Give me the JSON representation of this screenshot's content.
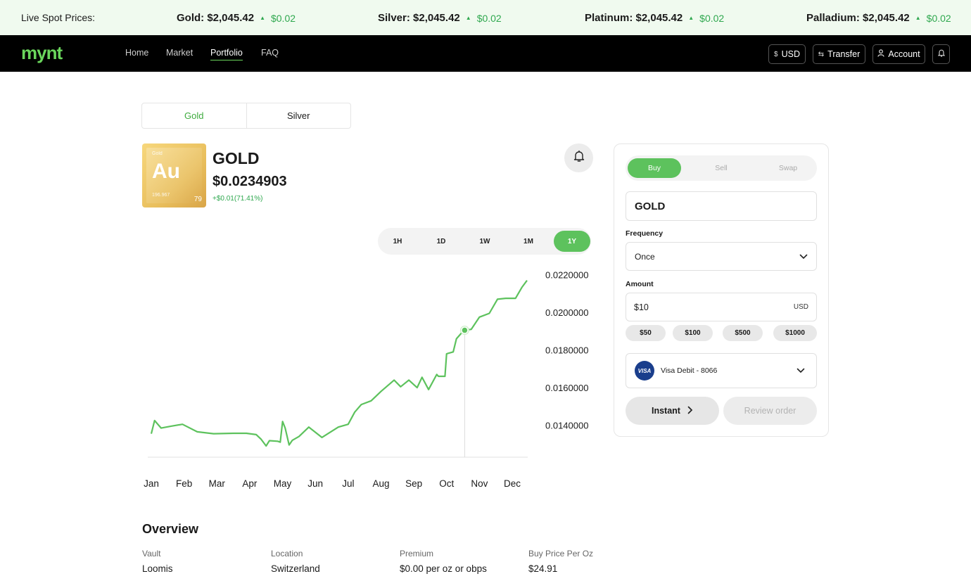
{
  "ticker": {
    "label": "Live Spot Prices:",
    "items": [
      {
        "name": "Gold: $2,045.42",
        "change": "$0.02"
      },
      {
        "name": "Silver: $2,045.42",
        "change": "$0.02"
      },
      {
        "name": "Platinum: $2,045.42",
        "change": "$0.02"
      },
      {
        "name": "Palladium: $2,045.42",
        "change": "$0.02"
      }
    ]
  },
  "nav": {
    "logo": "mynt",
    "links": [
      "Home",
      "Market",
      "Portfolio",
      "FAQ"
    ],
    "active": "Portfolio",
    "currency_label": "USD",
    "transfer_label": "Transfer",
    "account_label": "Account"
  },
  "metal_tabs": [
    "Gold",
    "Silver"
  ],
  "asset": {
    "tile_small": "Gold",
    "symbol": "Au",
    "atomic_mass": "196.967",
    "atomic_number": "79",
    "name": "GOLD",
    "price": "$0.0234903",
    "change": "+$0.01(71.41%)"
  },
  "ranges": [
    "1H",
    "1D",
    "1W",
    "1M",
    "1Y"
  ],
  "selected_range": "1Y",
  "chart_data": {
    "type": "line",
    "x_ticks": [
      "Jan",
      "Feb",
      "Mar",
      "Apr",
      "May",
      "Jun",
      "Jul",
      "Aug",
      "Sep",
      "Oct",
      "Nov",
      "Dec"
    ],
    "y_ticks": [
      "0.0220000",
      "0.0200000",
      "0.0180000",
      "0.0160000",
      "0.0140000"
    ],
    "ylim": [
      0.0123,
      0.0224
    ],
    "series": [
      {
        "x": 0.0,
        "y": 0.01355
      },
      {
        "x": 0.1,
        "y": 0.01425
      },
      {
        "x": 0.3,
        "y": 0.01385
      },
      {
        "x": 0.6,
        "y": 0.01395
      },
      {
        "x": 0.95,
        "y": 0.01405
      },
      {
        "x": 1.4,
        "y": 0.01365
      },
      {
        "x": 1.9,
        "y": 0.01355
      },
      {
        "x": 2.5,
        "y": 0.01357
      },
      {
        "x": 2.9,
        "y": 0.01357
      },
      {
        "x": 3.2,
        "y": 0.0135
      },
      {
        "x": 3.35,
        "y": 0.01325
      },
      {
        "x": 3.5,
        "y": 0.0129
      },
      {
        "x": 3.6,
        "y": 0.01318
      },
      {
        "x": 3.85,
        "y": 0.01315
      },
      {
        "x": 3.93,
        "y": 0.0131
      },
      {
        "x": 4.0,
        "y": 0.0142
      },
      {
        "x": 4.08,
        "y": 0.01385
      },
      {
        "x": 4.2,
        "y": 0.01295
      },
      {
        "x": 4.3,
        "y": 0.0132
      },
      {
        "x": 4.5,
        "y": 0.0134
      },
      {
        "x": 4.8,
        "y": 0.0139
      },
      {
        "x": 5.2,
        "y": 0.01335
      },
      {
        "x": 5.7,
        "y": 0.0139
      },
      {
        "x": 6.0,
        "y": 0.01405
      },
      {
        "x": 6.2,
        "y": 0.0147
      },
      {
        "x": 6.4,
        "y": 0.0151
      },
      {
        "x": 6.7,
        "y": 0.0153
      },
      {
        "x": 7.0,
        "y": 0.0158
      },
      {
        "x": 7.4,
        "y": 0.0164
      },
      {
        "x": 7.6,
        "y": 0.01605
      },
      {
        "x": 7.85,
        "y": 0.0164
      },
      {
        "x": 8.1,
        "y": 0.016
      },
      {
        "x": 8.25,
        "y": 0.01655
      },
      {
        "x": 8.45,
        "y": 0.0159
      },
      {
        "x": 8.7,
        "y": 0.0167
      },
      {
        "x": 8.75,
        "y": 0.0166
      },
      {
        "x": 8.95,
        "y": 0.0166
      },
      {
        "x": 9.0,
        "y": 0.0178
      },
      {
        "x": 9.2,
        "y": 0.0179
      },
      {
        "x": 9.3,
        "y": 0.0186
      },
      {
        "x": 9.45,
        "y": 0.0189
      },
      {
        "x": 9.55,
        "y": 0.01905
      },
      {
        "x": 9.75,
        "y": 0.0191
      },
      {
        "x": 10.0,
        "y": 0.01975
      },
      {
        "x": 10.3,
        "y": 0.01995
      },
      {
        "x": 10.55,
        "y": 0.0207
      },
      {
        "x": 10.8,
        "y": 0.02075
      },
      {
        "x": 11.1,
        "y": 0.02075
      },
      {
        "x": 11.3,
        "y": 0.02135
      },
      {
        "x": 11.45,
        "y": 0.0217
      }
    ],
    "marker": {
      "x": 9.55,
      "y": 0.01905
    },
    "color": "#5dc25d"
  },
  "overview": {
    "title": "Overview",
    "items": [
      {
        "label": "Vault",
        "value": "Loomis"
      },
      {
        "label": "Location",
        "value": "Switzerland"
      },
      {
        "label": "Premium",
        "value": "$0.00 per oz or obps"
      },
      {
        "label": "Buy Price Per Oz",
        "value": "$24.91"
      }
    ]
  },
  "trade": {
    "tabs": [
      "Buy",
      "Sell",
      "Swap"
    ],
    "active_tab": "Buy",
    "asset_field": "GOLD",
    "frequency_label": "Frequency",
    "frequency_value": "Once",
    "amount_label": "Amount",
    "amount_value": "$10",
    "amount_currency": "USD",
    "quick_amounts": [
      "$50",
      "$100",
      "$500",
      "$1000"
    ],
    "payment_icon": "VISA",
    "payment_method": "Visa Debit - 8066",
    "instant_label": "Instant",
    "review_label": "Review order"
  },
  "colors": {
    "accent": "#5dc25d",
    "up": "#2fa84f",
    "nav_bg": "#000000",
    "ticker_bg": "#f0faef"
  }
}
